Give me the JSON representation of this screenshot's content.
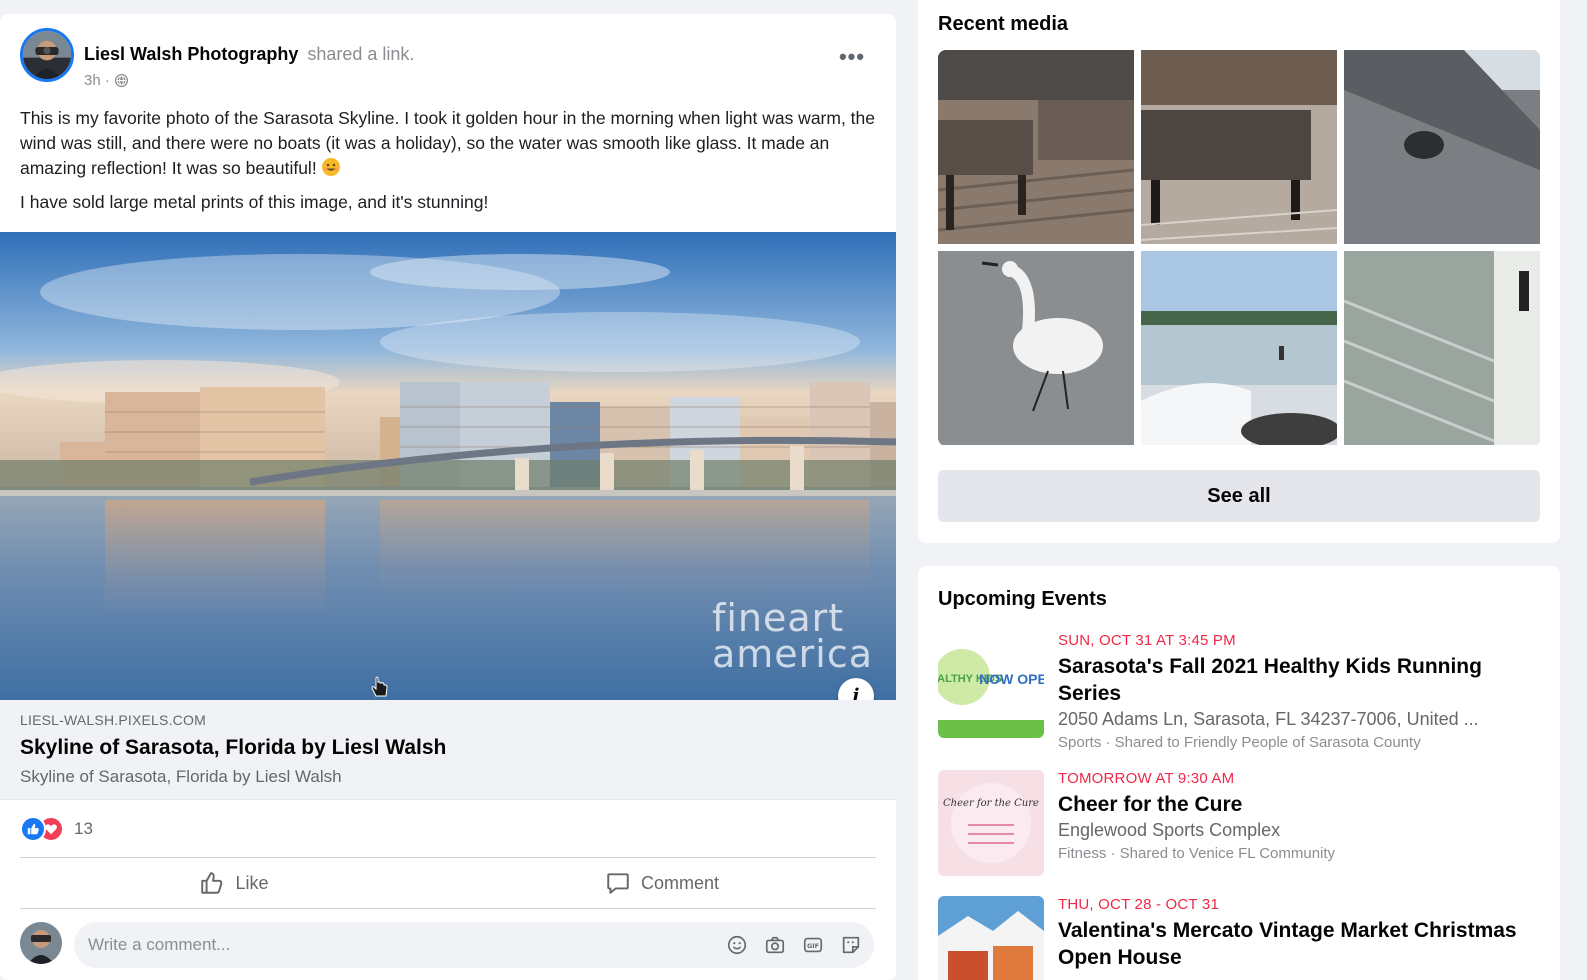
{
  "post": {
    "author": "Liesl Walsh Photography",
    "action": "shared a link.",
    "time": "3h ·",
    "more_label": "•••",
    "body_line_1": "This is my favorite photo of the Sarasota Skyline. I took it golden hour in the morning when light was warm, the wind was still, and there were no boats (it was a holiday), so the water was smooth like glass. It made an amazing reflection! It was so beautiful!",
    "body_line_2": "I have sold large metal prints of this image, and it's stunning!",
    "watermark": "fineart america",
    "info_label": "i",
    "link": {
      "domain": "LIESL-WALSH.PIXELS.COM",
      "title": "Skyline of Sarasota, Florida by Liesl Walsh",
      "description": "Skyline of Sarasota, Florida by Liesl Walsh"
    },
    "reactions": {
      "count": "13",
      "types": [
        "like-icon",
        "love-icon"
      ]
    },
    "actions": {
      "like_label": "Like",
      "comment_label": "Comment"
    },
    "comment_box": {
      "placeholder": "Write a comment...",
      "tools": [
        "emoji-icon",
        "camera-icon",
        "gif-icon",
        "sticker-icon"
      ]
    }
  },
  "recent_media": {
    "title": "Recent media",
    "thumbnails": [
      "wood-table-photo",
      "patio-table-photo",
      "rocky-shore-photo",
      "egret-photo",
      "beach-waves-photo",
      "wood-floor-photo"
    ],
    "see_all_label": "See all"
  },
  "upcoming_events": {
    "title": "Upcoming Events",
    "events": [
      {
        "date": "SUN, OCT 31 AT 3:45 PM",
        "title": "Sarasota's Fall 2021 Healthy Kids Running Series",
        "location": "2050 Adams Ln, Sarasota, FL 34237-7006, United ...",
        "meta": "Sports · Shared to Friendly People of Sarasota County",
        "thumb_text_1": "HEALTHY KIDS",
        "thumb_text_2": "NOW OPEN"
      },
      {
        "date": "TOMORROW AT 9:30 AM",
        "title": "Cheer for the Cure",
        "location": "Englewood Sports Complex",
        "meta": "Fitness · Shared to Venice FL Community",
        "thumb_text_1": "Cheer for the Cure"
      },
      {
        "date": "THU, OCT 28 - OCT 31",
        "title": "Valentina's Mercato Vintage Market Christmas Open House"
      }
    ]
  },
  "colors": {
    "accent": "#1877f2",
    "love": "#f33e58",
    "event_date": "#f02849",
    "background": "#f0f2f5"
  }
}
